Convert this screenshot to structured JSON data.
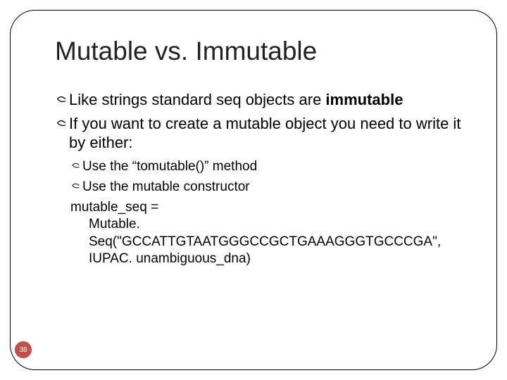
{
  "title": "Mutable vs. Immutable",
  "bullets": {
    "b1_pre": "Like strings standard seq objects are ",
    "b1_bold": "immutable",
    "b2": "If you want to create a mutable object you need to write it by either:"
  },
  "sub": {
    "s1": "Use the “tomutable()” method",
    "s2": "Use the mutable constructor",
    "code1": "mutable_seq =",
    "code2": "Mutable. Seq(\"GCCATTGTAATGGGCCGCTGAAAGGGTGCCCGA\", IUPAC. unambiguous_dna)"
  },
  "page_number": "38",
  "colors": {
    "badge": "#c0504d"
  }
}
